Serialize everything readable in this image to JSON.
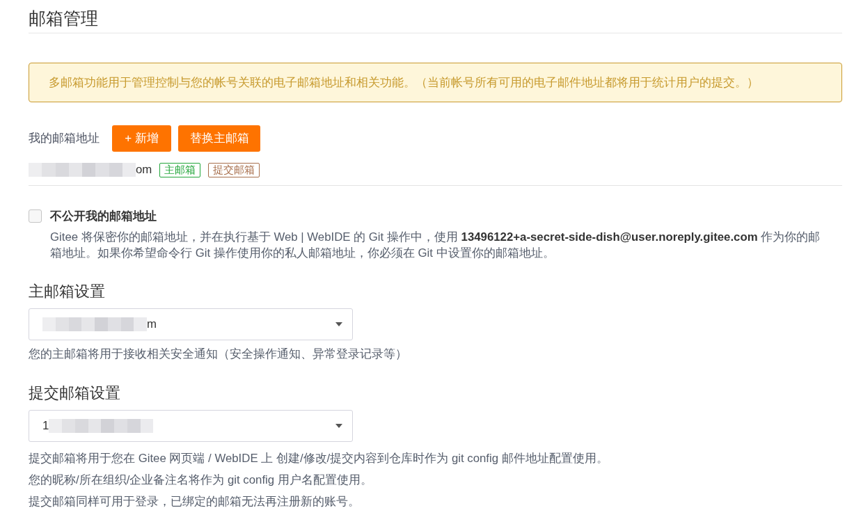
{
  "page": {
    "title": "邮箱管理"
  },
  "alert": {
    "text": "多邮箱功能用于管理控制与您的帐号关联的电子邮箱地址和相关功能。（当前帐号所有可用的电子邮件地址都将用于统计用户的提交。）"
  },
  "my_emails": {
    "label": "我的邮箱地址",
    "buttons": [
      {
        "kind": "add",
        "label": "+ 新增"
      },
      {
        "kind": "replace",
        "label": "替换主邮箱"
      }
    ],
    "addresses": [
      {
        "redacted": true,
        "shown_end": "om",
        "tags": [
          {
            "label": "主邮箱",
            "color": "#22a63a"
          },
          {
            "label": "提交邮箱",
            "color": "#a86f4c"
          }
        ]
      }
    ]
  },
  "privacy": {
    "checked": false,
    "label": "不公开我的邮箱地址",
    "description": "Gitee 将保密你的邮箱地址，并在执行基于 Web | WebIDE 的 Git 操作中，使用 **13496122+a-secret-side-dish@user.noreply.gitee.com** 作为你的邮箱地址。如果你希望命令行 Git 操作使用你的私人邮箱地址，你必须在 Git 中设置你的邮箱地址。"
  },
  "settings": [
    {
      "heading": "主邮箱设置",
      "select": {
        "redacted": true,
        "shown_end": "m"
      },
      "help": [
        "您的主邮箱将用于接收相关安全通知（安全操作通知、异常登录记录等）"
      ]
    },
    {
      "heading": "提交邮箱设置",
      "select": {
        "redacted": true,
        "shown_start": "1"
      },
      "help": [
        "提交邮箱将用于您在 Gitee 网页端 / WebIDE 上 创建/修改/提交内容到仓库时作为 git config 邮件地址配置使用。",
        "您的昵称/所在组织/企业备注名将作为 git config 用户名配置使用。",
        "提交邮箱同样可用于登录，已绑定的邮箱无法再注册新的账号。"
      ]
    }
  ]
}
